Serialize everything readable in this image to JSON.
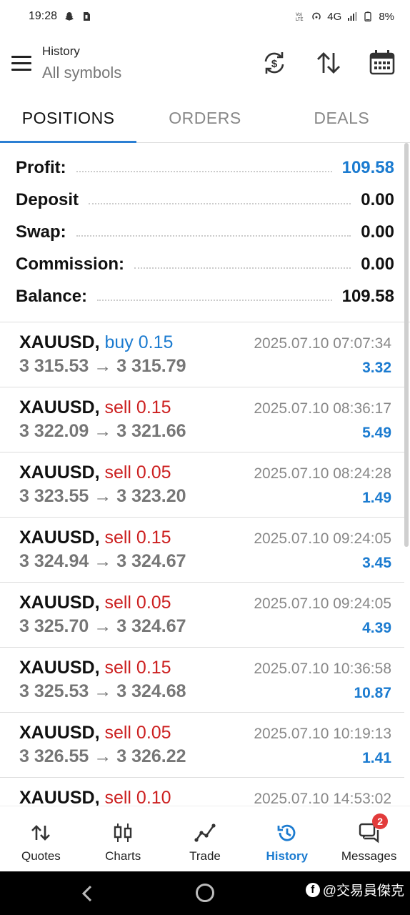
{
  "status_bar": {
    "time": "19:28",
    "network": "4G",
    "battery": "8%"
  },
  "header": {
    "title": "History",
    "subtitle": "All symbols"
  },
  "tabs": [
    {
      "label": "POSITIONS",
      "active": true
    },
    {
      "label": "ORDERS",
      "active": false
    },
    {
      "label": "DEALS",
      "active": false
    }
  ],
  "summary": {
    "profit_label": "Profit:",
    "profit_value": "109.58",
    "deposit_label": "Deposit",
    "deposit_value": "0.00",
    "swap_label": "Swap:",
    "swap_value": "0.00",
    "commission_label": "Commission:",
    "commission_value": "0.00",
    "balance_label": "Balance:",
    "balance_value": "109.58"
  },
  "deals": [
    {
      "symbol": "XAUUSD,",
      "side": "buy 0.15",
      "type": "buy",
      "open": "3 315.53",
      "close": "3 315.79",
      "time": "2025.07.10 07:07:34",
      "profit": "3.32"
    },
    {
      "symbol": "XAUUSD,",
      "side": "sell 0.15",
      "type": "sell",
      "open": "3 322.09",
      "close": "3 321.66",
      "time": "2025.07.10 08:36:17",
      "profit": "5.49"
    },
    {
      "symbol": "XAUUSD,",
      "side": "sell 0.05",
      "type": "sell",
      "open": "3 323.55",
      "close": "3 323.20",
      "time": "2025.07.10 08:24:28",
      "profit": "1.49"
    },
    {
      "symbol": "XAUUSD,",
      "side": "sell 0.15",
      "type": "sell",
      "open": "3 324.94",
      "close": "3 324.67",
      "time": "2025.07.10 09:24:05",
      "profit": "3.45"
    },
    {
      "symbol": "XAUUSD,",
      "side": "sell 0.05",
      "type": "sell",
      "open": "3 325.70",
      "close": "3 324.67",
      "time": "2025.07.10 09:24:05",
      "profit": "4.39"
    },
    {
      "symbol": "XAUUSD,",
      "side": "sell 0.15",
      "type": "sell",
      "open": "3 325.53",
      "close": "3 324.68",
      "time": "2025.07.10 10:36:58",
      "profit": "10.87"
    },
    {
      "symbol": "XAUUSD,",
      "side": "sell 0.05",
      "type": "sell",
      "open": "3 326.55",
      "close": "3 326.22",
      "time": "2025.07.10 10:19:13",
      "profit": "1.41"
    },
    {
      "symbol": "XAUUSD,",
      "side": "sell 0.10",
      "type": "sell",
      "open": "",
      "close": "",
      "time": "2025.07.10 14:53:02",
      "profit": ""
    }
  ],
  "arrow": "→",
  "bottom_nav": [
    {
      "label": "Quotes",
      "icon": "quotes-icon",
      "active": false
    },
    {
      "label": "Charts",
      "icon": "charts-icon",
      "active": false
    },
    {
      "label": "Trade",
      "icon": "trade-icon",
      "active": false
    },
    {
      "label": "History",
      "icon": "history-icon",
      "active": true
    },
    {
      "label": "Messages",
      "icon": "messages-icon",
      "active": false,
      "badge": "2"
    }
  ],
  "watermark": "@交易員傑克",
  "colors": {
    "accent": "#1b7bd0",
    "sell": "#cc1f1f",
    "buy": "#1b7bd0"
  }
}
